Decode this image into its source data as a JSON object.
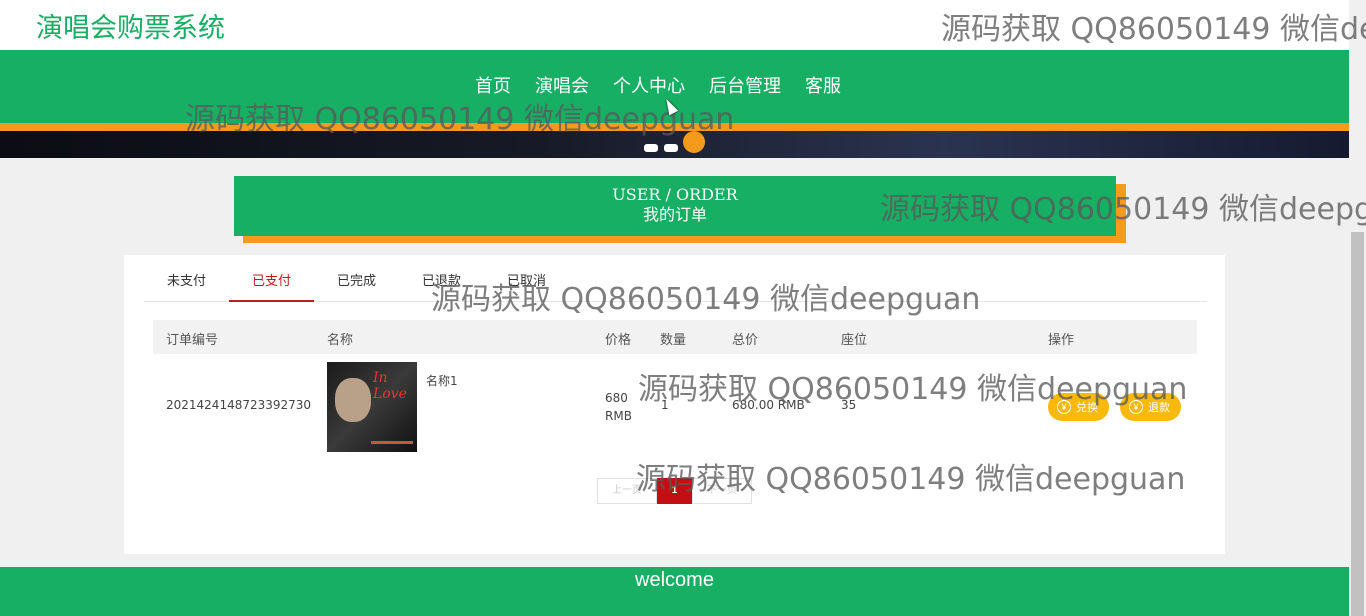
{
  "site": {
    "title": "演唱会购票系统"
  },
  "nav": {
    "items": [
      "首页",
      "演唱会",
      "个人中心",
      "后台管理",
      "客服"
    ]
  },
  "section": {
    "title_en": "USER / ORDER",
    "title_cn": "我的订单"
  },
  "tabs": {
    "items": [
      "未支付",
      "已支付",
      "已完成",
      "已退款",
      "已取消"
    ],
    "active": "已支付"
  },
  "table": {
    "headers": [
      "订单编号",
      "名称",
      "价格",
      "数量",
      "总价",
      "座位",
      "操作"
    ],
    "rows": [
      {
        "order_id": "2021424148723392730",
        "name": "名称1",
        "price": "680 RMB",
        "quantity": "1",
        "total": "680.00 RMB",
        "seat": "35",
        "actions": [
          "兑换",
          "退款"
        ],
        "poster_text": "In Love"
      }
    ]
  },
  "pagination": {
    "prev": "上一页",
    "current": "1",
    "next": "下一页"
  },
  "footer": {
    "text": "welcome"
  },
  "watermark": {
    "text": "源码获取 QQ86050149 微信deepguan"
  },
  "colors": {
    "primary": "#16af63",
    "accent": "#f49b1e",
    "active_tab": "#c21b1b",
    "action_button": "#f9b90b",
    "page_current": "#c30f13"
  }
}
